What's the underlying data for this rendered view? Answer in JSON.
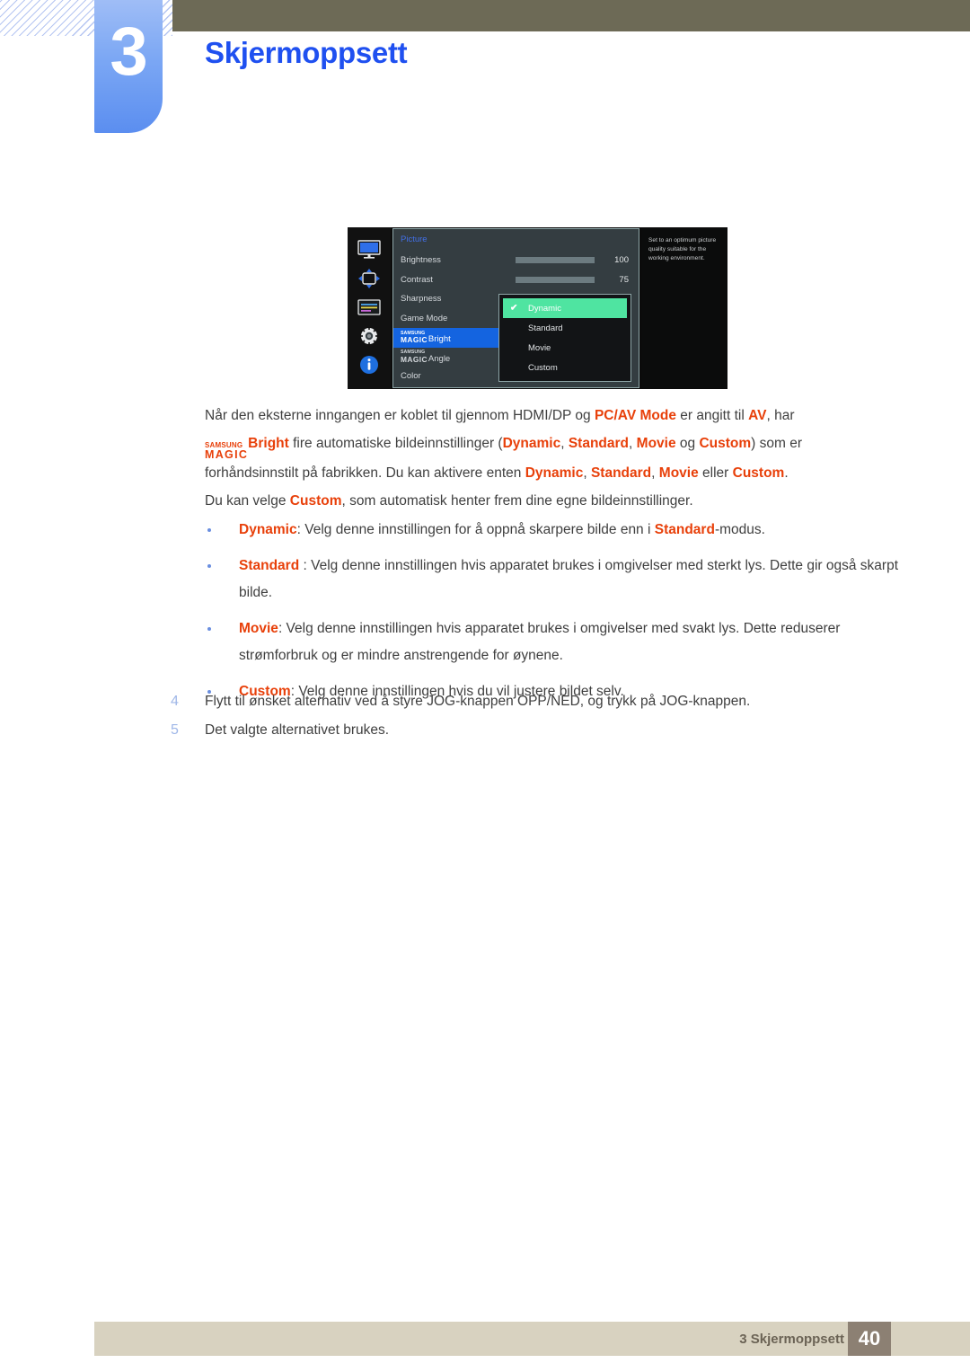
{
  "header": {
    "chapter_number": "3",
    "chapter_title": "Skjermoppsett"
  },
  "osd": {
    "menu_title": "Picture",
    "icons": [
      {
        "name": "display-icon"
      },
      {
        "name": "position-arrows-icon"
      },
      {
        "name": "osd-lines-icon"
      },
      {
        "name": "gear-icon"
      },
      {
        "name": "info-icon"
      }
    ],
    "rows": [
      {
        "label": "Brightness",
        "value": "100",
        "slider": 100
      },
      {
        "label": "Contrast",
        "value": "75",
        "slider": 75
      },
      {
        "label": "Sharpness",
        "value": "",
        "slider": null
      },
      {
        "label": "Game Mode",
        "value": "",
        "slider": null
      }
    ],
    "magic_bright": {
      "brand_top": "SAMSUNG",
      "brand_bottom": "MAGIC",
      "word": "Bright"
    },
    "magic_angle": {
      "brand_top": "SAMSUNG",
      "brand_bottom": "MAGIC",
      "word": "Angle"
    },
    "color_label": "Color",
    "submenu": {
      "items": [
        "Dynamic",
        "Standard",
        "Movie",
        "Custom"
      ],
      "selected": "Dynamic",
      "check_glyph": "✔"
    },
    "help_text": "Set to an optimum picture quality suitable for the working environment.",
    "colors": {
      "panel_bg": "#343d41",
      "highlight_blue": "#1464e0",
      "submenu_green": "#4fe4a1",
      "title_blue": "#4270e8"
    }
  },
  "body": {
    "paragraph": {
      "p1_a": "Når den eksterne inngangen er koblet til gjennom HDMI/DP og ",
      "p1_b": "PC/AV Mode",
      "p1_c": " er angitt til ",
      "p1_d": "AV",
      "p1_e": ", har",
      "p2_a": " fire automatiske bildeinnstillinger (",
      "p2_b": "Dynamic",
      "p2_c": ", ",
      "p2_d": "Standard",
      "p2_e": ", ",
      "p2_f": "Movie",
      "p2_g": " og ",
      "p2_h": "Custom",
      "p2_i": ") som er",
      "p3_a": "forhåndsinnstilt på fabrikken. Du kan aktivere enten ",
      "p3_b": "Dynamic",
      "p3_c": ", ",
      "p3_d": "Standard",
      "p3_e": ", ",
      "p3_f": "Movie",
      "p3_g": " eller ",
      "p3_h": "Custom",
      "p3_i": ".",
      "p4_a": "Du kan velge ",
      "p4_b": "Custom",
      "p4_c": ", som automatisk henter frem dine egne bildeinnstillinger."
    },
    "bullets": [
      {
        "term": "Dynamic",
        "text": ": Velg denne innstillingen for å oppnå skarpere bilde enn i ",
        "term2": "Standard",
        "tail": "-modus."
      },
      {
        "term": "Standard",
        "text": " : Velg denne innstillingen hvis apparatet brukes i omgivelser med sterkt lys. Dette gir også skarpt bilde.",
        "term2": "",
        "tail": ""
      },
      {
        "term": "Movie",
        "text": ": Velg denne innstillingen hvis apparatet brukes i omgivelser med svakt lys. Dette reduserer strømforbruk og er mindre anstrengende for øynene.",
        "term2": "",
        "tail": ""
      },
      {
        "term": "Custom",
        "text": ": Velg denne innstillingen hvis du vil justere bildet selv.",
        "term2": "",
        "tail": ""
      }
    ],
    "steps": [
      {
        "num": "4",
        "text": "Flytt til ønsket alternativ ved å styre JOG-knappen OPP/NED, og trykk på JOG-knappen."
      },
      {
        "num": "5",
        "text": "Det valgte alternativet brukes."
      }
    ]
  },
  "footer": {
    "text": "3 Skjermoppsett",
    "page": "40"
  }
}
